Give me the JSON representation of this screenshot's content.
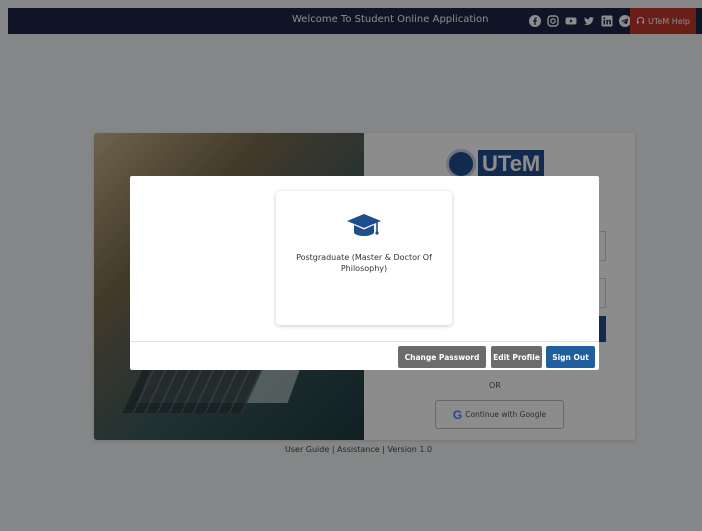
{
  "header": {
    "title": "Welcome To Student Online Application",
    "socials": [
      "facebook-icon",
      "instagram-icon",
      "youtube-icon",
      "twitter-icon",
      "linkedin-icon",
      "telegram-icon"
    ],
    "help_label": "UTeM Help"
  },
  "login": {
    "logo_text": "UTeM",
    "or_text": "OR",
    "google_label": "Continue with Google"
  },
  "footer": {
    "links": "User Guide | Assistance | Version 1.0"
  },
  "modal": {
    "option_label": "Postgraduate (Master & Doctor Of Philosophy)",
    "buttons": {
      "change_password": "Change Password",
      "edit_profile": "Edit Profile",
      "sign_out": "Sign Out"
    }
  },
  "colors": {
    "topbar": "#1d2645",
    "help": "#c0392b",
    "primary": "#1f5f9e",
    "secondary_button": "#6c6c6c"
  }
}
